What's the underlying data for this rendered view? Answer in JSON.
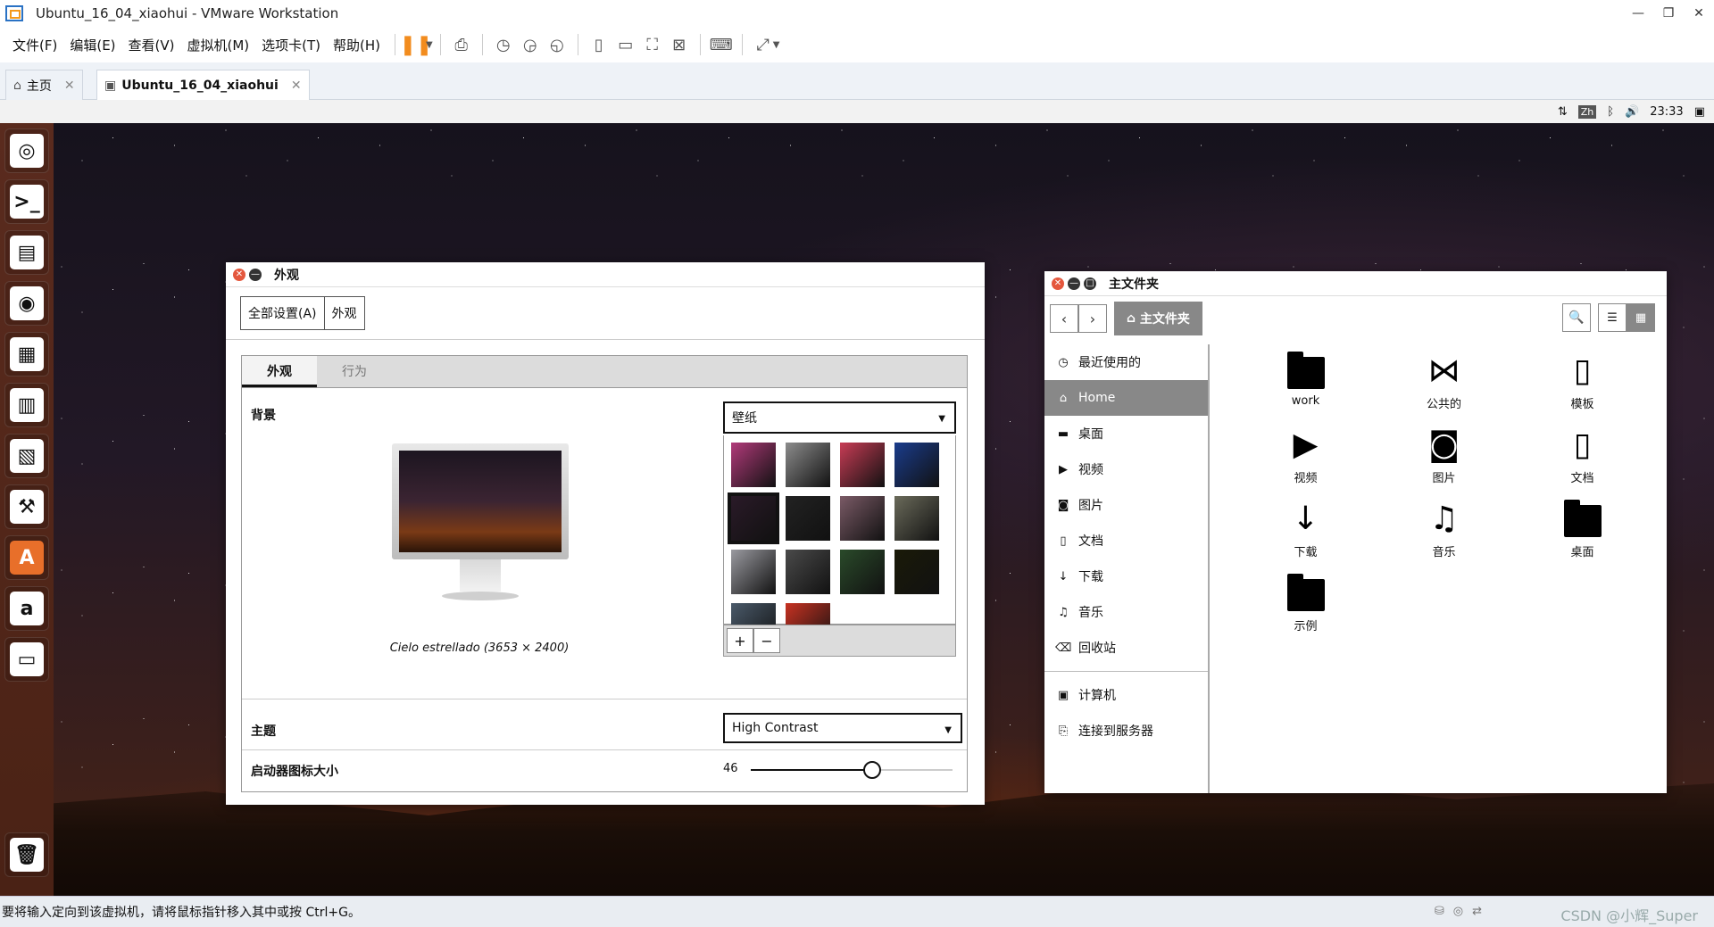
{
  "host": {
    "window_title": "Ubuntu_16_04_xiaohui - VMware Workstation",
    "menus": [
      "文件(F)",
      "编辑(E)",
      "查看(V)",
      "虚拟机(M)",
      "选项卡(T)",
      "帮助(H)"
    ],
    "tabs": [
      {
        "label": "主页",
        "icon": "home-icon"
      },
      {
        "label": "Ubuntu_16_04_xiaohui",
        "icon": "vm-icon"
      }
    ],
    "status_text": "要将输入定向到该虚拟机，请将鼠标指针移入其中或按 Ctrl+G。",
    "watermark": "CSDN @小辉_Super"
  },
  "guest": {
    "panel": {
      "lang": "Zh",
      "time": "23:33"
    },
    "launcher": [
      "ubuntu-dash-icon",
      "terminal-icon",
      "files-icon",
      "firefox-icon",
      "writer-icon",
      "calc-icon",
      "impress-icon",
      "system-settings-icon",
      "software-center-icon",
      "amazon-icon",
      "vm-display-icon"
    ],
    "appearance": {
      "title": "外观",
      "breadcrumb": [
        "全部设置(A)",
        "外观"
      ],
      "tabs": [
        "外观",
        "行为"
      ],
      "background_label": "背景",
      "background_caption": "Cielo estrellado (3653 × 2400)",
      "wallpaper_source": "壁纸",
      "theme_label": "主题",
      "theme_value": "High Contrast",
      "icon_size_label": "启动器图标大小",
      "icon_size_value": "46",
      "icon_size_fraction": 0.6,
      "wallpapers": [
        "#b23a7a",
        "#8c8c8c",
        "#c83c55",
        "#1a3c8c",
        "#2a1a28",
        "#222222",
        "#7a5a66",
        "#6a6a5a",
        "#9a9aa0",
        "#4a4a4a",
        "#2a4a2a",
        "#1a1a08",
        "#4a5a6a",
        "#c83222"
      ],
      "selected_wallpaper": 4
    },
    "files": {
      "title": "主文件夹",
      "path_button": "主文件夹",
      "sidebar": [
        {
          "label": "最近使用的",
          "icon": "clock-icon"
        },
        {
          "label": "Home",
          "icon": "home-icon",
          "active": true
        },
        {
          "label": "桌面",
          "icon": "folder-icon"
        },
        {
          "label": "视频",
          "icon": "video-icon"
        },
        {
          "label": "图片",
          "icon": "camera-icon"
        },
        {
          "label": "文档",
          "icon": "document-icon"
        },
        {
          "label": "下载",
          "icon": "download-icon"
        },
        {
          "label": "音乐",
          "icon": "music-icon"
        },
        {
          "label": "回收站",
          "icon": "trash-icon"
        }
      ],
      "sidebar_devices": [
        {
          "label": "计算机",
          "icon": "computer-icon"
        },
        {
          "label": "连接到服务器",
          "icon": "server-icon"
        }
      ],
      "items": [
        {
          "label": "work",
          "icon": "folder-icon"
        },
        {
          "label": "公共的",
          "icon": "share-icon"
        },
        {
          "label": "模板",
          "icon": "template-icon"
        },
        {
          "label": "视频",
          "icon": "video-icon"
        },
        {
          "label": "图片",
          "icon": "camera-icon"
        },
        {
          "label": "文档",
          "icon": "document-icon"
        },
        {
          "label": "下载",
          "icon": "download-icon"
        },
        {
          "label": "音乐",
          "icon": "music-icon"
        },
        {
          "label": "桌面",
          "icon": "folder-icon"
        },
        {
          "label": "示例",
          "icon": "examples-folder-icon"
        }
      ]
    }
  }
}
